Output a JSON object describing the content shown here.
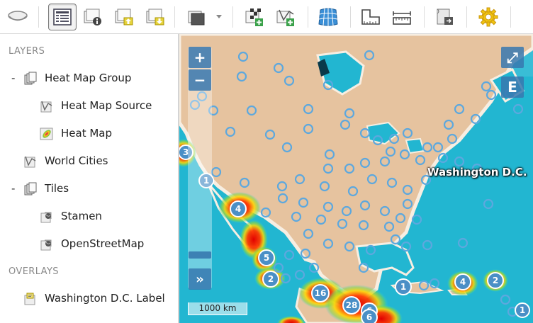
{
  "toolbar": {
    "buttons": [
      {
        "name": "map-frame-button",
        "icon": "map-frame-icon"
      },
      {
        "name": "layer-list-button",
        "icon": "layer-list-icon",
        "active": true
      },
      {
        "name": "layer-info-button",
        "icon": "layer-info-icon"
      },
      {
        "name": "layer-move-up-button",
        "icon": "move-up-icon"
      },
      {
        "name": "layer-move-down-button",
        "icon": "move-down-icon"
      },
      {
        "name": "basemap-dropdown-button",
        "icon": "layer-stack-icon"
      },
      {
        "name": "add-raster-layer-button",
        "icon": "add-raster-icon"
      },
      {
        "name": "add-vector-layer-button",
        "icon": "add-vector-icon"
      },
      {
        "name": "projection-button",
        "icon": "globe-grid-icon"
      },
      {
        "name": "measure-area-button",
        "icon": "measure-area-icon"
      },
      {
        "name": "measure-distance-button",
        "icon": "ruler-icon"
      },
      {
        "name": "export-button",
        "icon": "export-icon"
      },
      {
        "name": "settings-button",
        "icon": "gear-icon"
      }
    ]
  },
  "sidebar": {
    "layers_title": "LAYERS",
    "overlays_title": "OVERLAYS",
    "items": [
      {
        "label": "Heat Map Group",
        "toggle": "-",
        "icon": "layer-group-icon"
      },
      {
        "label": "Heat Map Source",
        "icon": "vector-source-icon"
      },
      {
        "label": "Heat Map",
        "icon": "heatmap-icon"
      },
      {
        "label": "World Cities",
        "icon": "vector-source-icon"
      },
      {
        "label": "Tiles",
        "toggle": "-",
        "icon": "layer-group-icon"
      },
      {
        "label": "Stamen",
        "icon": "tile-layer-icon"
      },
      {
        "label": "OpenStreetMap",
        "icon": "tile-layer-icon"
      }
    ],
    "overlays": [
      {
        "label": "Washington D.C. Label",
        "icon": "overlay-label-icon"
      }
    ]
  },
  "map": {
    "zoom_in": "+",
    "zoom_out": "−",
    "expand_toggle": "»",
    "fullscreen": "⤢",
    "extent_button": "E",
    "city_label": "Washington D.C.",
    "scale_label": "1000 km",
    "clusters": [
      "3",
      "1",
      "4",
      "5",
      "2",
      "16",
      "28",
      "6",
      "6",
      "1",
      "4",
      "2",
      "1"
    ]
  },
  "colors": {
    "ocean": "#1fb4cf",
    "land": "#e8c9a6",
    "accent": "#3778af",
    "cluster_fill": "#4a8fc6"
  }
}
